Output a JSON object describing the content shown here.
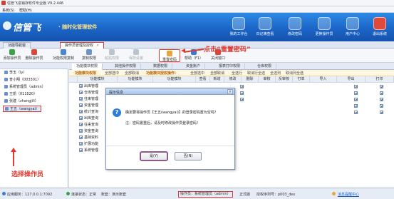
{
  "window": {
    "title": "信管飞进销存软件专业版 V9.2.446"
  },
  "menu": [
    "系统(S)",
    "帮助(H)"
  ],
  "banner": {
    "logo": "信管飞",
    "slogan": "· 随时化管理软件",
    "buttons": [
      "我的工作台",
      "日记簿查看",
      "修改密码",
      "更换操作员",
      "用户中心",
      "退出系统"
    ]
  },
  "top_tabs": [
    {
      "label": "功能导航窗"
    },
    {
      "label": "操作员管理及授权",
      "close": "×"
    }
  ],
  "toolbar": {
    "items": [
      "添加操作员",
      "删除操作员",
      "功能权限复制",
      "复制权限",
      "粘贴权限",
      "保存设置",
      "重置密码",
      "帮助（F1）",
      "关闭窗口"
    ],
    "callout": "点击“重置密码”"
  },
  "left_panel": {
    "header": "",
    "items": [
      "李玉（ly）",
      "普小翔（003301）",
      "系统管理员（admin）",
      "王凯（011020）",
      "张建（zhangjili）",
      "王五（wangyai）"
    ],
    "selected_index": 5,
    "caption": "选择操作员"
  },
  "sub_tabs": [
    "功能模块权限",
    "其他操作权限",
    "数据权限",
    "资金账户",
    "报表打印权限",
    "仓库权限"
  ],
  "action_row": {
    "left_title": "功能模块权限",
    "left_actions": [
      "全部选中",
      "全部取消"
    ],
    "right_title": "功能模块授权操作：",
    "right_actions": [
      "全部选中",
      "全部取消",
      "全选行",
      "取消行全选",
      "全选列",
      "取消列全选"
    ]
  },
  "grid": {
    "left_headers": [
      "",
      "功能模块"
    ],
    "right_headers": [
      "功能模块",
      "功能模块",
      "查看",
      "新增",
      "修改",
      "删除",
      "审核",
      "反审核",
      "打单",
      "导入",
      "导出",
      "打印"
    ],
    "tree_rows": [
      {
        "label": "出库管理",
        "checked": true
      },
      {
        "label": "仓库管理",
        "checked": true
      },
      {
        "label": "往来管理",
        "checked": true
      },
      {
        "label": "资金管理",
        "checked": true
      },
      {
        "label": "统计查询",
        "checked": true
      },
      {
        "label": "出库查询",
        "checked": true
      },
      {
        "label": "往来查询",
        "checked": true
      },
      {
        "label": "资金查询",
        "checked": true
      },
      {
        "label": "基础资料",
        "checked": true
      },
      {
        "label": "扩展功能",
        "checked": true
      },
      {
        "label": "系统管理",
        "checked": true
      }
    ]
  },
  "dialog": {
    "title": "提示信息",
    "close": "×",
    "message1": "确定要将操作员【王五(wangyai)】的登录密码置为空吗？",
    "message2": "注：密码置重后，请及时修改操作员登录密码！",
    "yes": "是(Y)",
    "no": "否(N)"
  },
  "status": {
    "app_server": "应用服务：127.0.0.1:7092",
    "connection": "连接状态：正常",
    "account_set": "账套：演示账套",
    "operator": "操作员：系统管理员（admin）",
    "edition": "正式版",
    "license": "授权序列号：p003_dex",
    "link": "消息提醒中心"
  }
}
